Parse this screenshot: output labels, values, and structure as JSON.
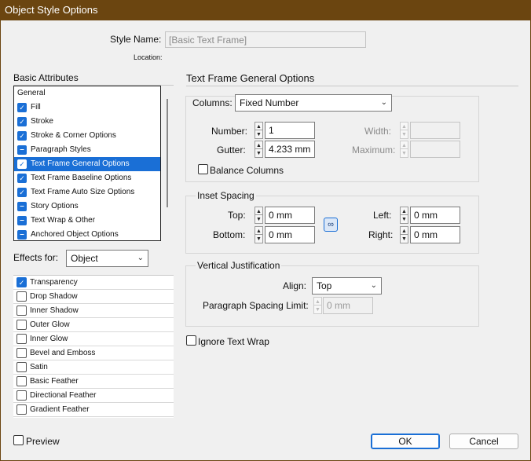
{
  "window": {
    "title": "Object Style Options"
  },
  "style_name": {
    "label": "Style Name:",
    "value": "[Basic Text Frame]"
  },
  "location": {
    "label": "Location:"
  },
  "basic_attributes": {
    "heading": "Basic Attributes",
    "items": [
      {
        "label": "General",
        "state": "none"
      },
      {
        "label": "Fill",
        "state": "checked"
      },
      {
        "label": "Stroke",
        "state": "checked"
      },
      {
        "label": "Stroke & Corner Options",
        "state": "checked"
      },
      {
        "label": "Paragraph Styles",
        "state": "ignored"
      },
      {
        "label": "Text Frame General Options",
        "state": "checked"
      },
      {
        "label": "Text Frame Baseline Options",
        "state": "checked"
      },
      {
        "label": "Text Frame Auto Size Options",
        "state": "checked"
      },
      {
        "label": "Story Options",
        "state": "ignored"
      },
      {
        "label": "Text Wrap & Other",
        "state": "ignored"
      },
      {
        "label": "Anchored Object Options",
        "state": "ignored"
      }
    ]
  },
  "effects_for": {
    "label": "Effects for:",
    "value": "Object",
    "items": [
      {
        "label": "Transparency",
        "checked": true
      },
      {
        "label": "Drop Shadow",
        "checked": false
      },
      {
        "label": "Inner Shadow",
        "checked": false
      },
      {
        "label": "Outer Glow",
        "checked": false
      },
      {
        "label": "Inner Glow",
        "checked": false
      },
      {
        "label": "Bevel and Emboss",
        "checked": false
      },
      {
        "label": "Satin",
        "checked": false
      },
      {
        "label": "Basic Feather",
        "checked": false
      },
      {
        "label": "Directional Feather",
        "checked": false
      },
      {
        "label": "Gradient Feather",
        "checked": false
      }
    ]
  },
  "panel": {
    "heading": "Text Frame General Options"
  },
  "columns": {
    "label": "Columns:",
    "value": "Fixed Number",
    "number_label": "Number:",
    "number_value": "1",
    "gutter_label": "Gutter:",
    "gutter_value": "4.233 mm",
    "width_label": "Width:",
    "width_value": "",
    "maximum_label": "Maximum:",
    "maximum_value": "",
    "balance_label": "Balance Columns"
  },
  "inset": {
    "heading": "Inset Spacing",
    "top_label": "Top:",
    "top_value": "0 mm",
    "bottom_label": "Bottom:",
    "bottom_value": "0 mm",
    "left_label": "Left:",
    "left_value": "0 mm",
    "right_label": "Right:",
    "right_value": "0 mm"
  },
  "vertical": {
    "heading": "Vertical Justification",
    "align_label": "Align:",
    "align_value": "Top",
    "psl_label": "Paragraph Spacing Limit:",
    "psl_value": "0 mm"
  },
  "ignore_wrap": {
    "label": "Ignore Text Wrap"
  },
  "preview": {
    "label": "Preview"
  },
  "buttons": {
    "ok": "OK",
    "cancel": "Cancel"
  },
  "colors": {
    "accent": "#1a6fd6",
    "titlebar": "#6b4510"
  }
}
